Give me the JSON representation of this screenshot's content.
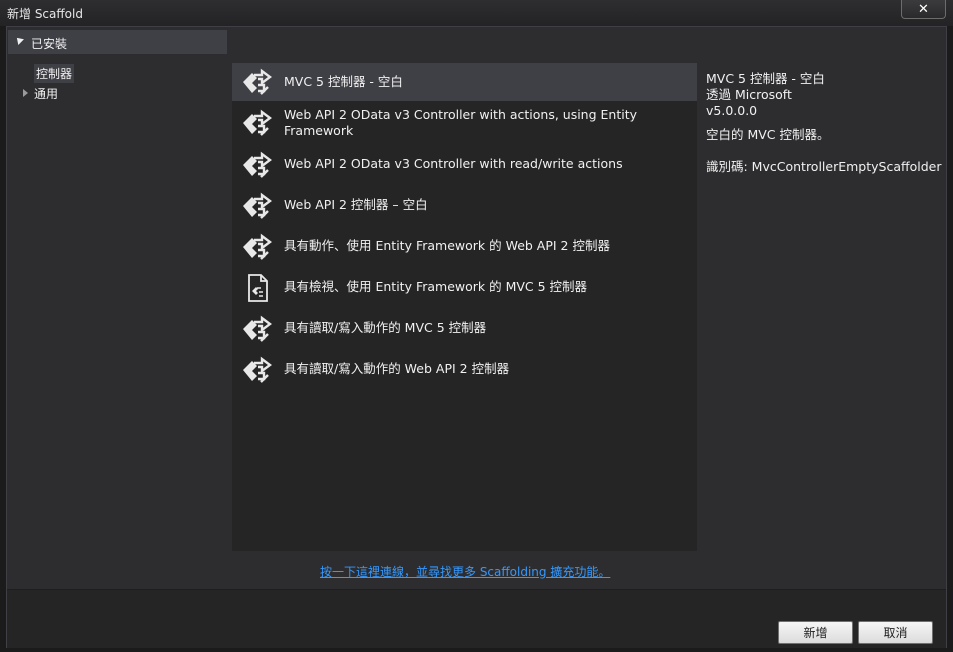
{
  "window": {
    "title": "新增 Scaffold",
    "close_glyph": "✕"
  },
  "sidebar": {
    "installed_label": "已安裝",
    "items": [
      {
        "label": "控制器",
        "selected": true
      },
      {
        "label": "通用",
        "selected": false
      }
    ]
  },
  "templates": [
    {
      "name": "MVC 5 控制器 - 空白",
      "icon": "controller-icon",
      "selected": true
    },
    {
      "name": "Web API 2 OData v3 Controller with actions, using Entity Framework",
      "icon": "controller-icon"
    },
    {
      "name": "Web API 2 OData v3 Controller with read/write actions",
      "icon": "controller-icon"
    },
    {
      "name": "Web API 2 控制器 – 空白",
      "icon": "controller-icon"
    },
    {
      "name": "具有動作、使用 Entity Framework 的 Web API 2 控制器",
      "icon": "controller-icon"
    },
    {
      "name": "具有檢視、使用 Entity Framework 的 MVC 5 控制器",
      "icon": "view-controller-icon"
    },
    {
      "name": "具有讀取/寫入動作的 MVC 5 控制器",
      "icon": "controller-icon"
    },
    {
      "name": "具有讀取/寫入動作的 Web API 2 控制器",
      "icon": "controller-icon"
    }
  ],
  "details": {
    "title": "MVC 5 控制器 - 空白",
    "by": "透過 Microsoft",
    "version": "v5.0.0.0",
    "description": "空白的 MVC 控制器。",
    "id": "識別碼: MvcControllerEmptyScaffolder"
  },
  "link_text": "按一下這裡連線，並尋找更多 Scaffolding 擴充功能。",
  "buttons": {
    "add": "新增",
    "cancel": "取消"
  }
}
